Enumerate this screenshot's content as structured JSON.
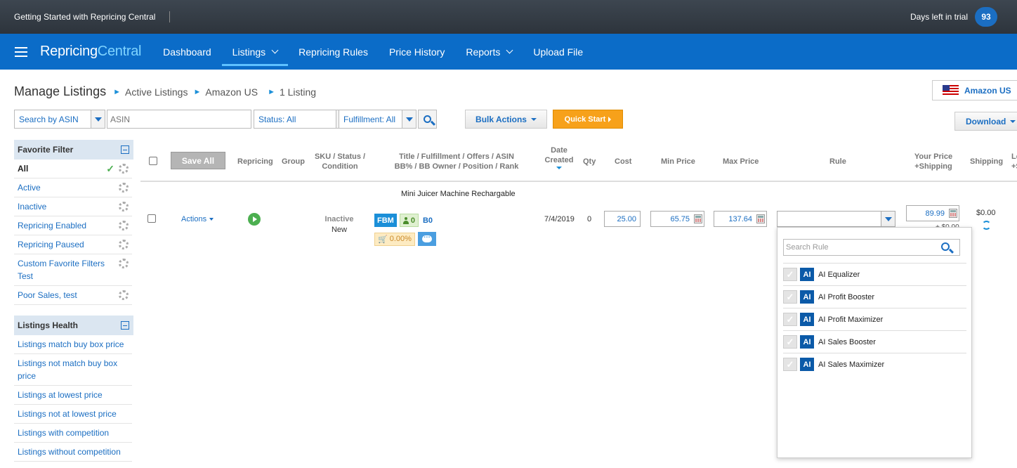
{
  "topbar": {
    "getting_started": "Getting Started with Repricing Central",
    "trial_label": "Days left in trial",
    "trial_days": "93"
  },
  "nav": {
    "logo_a": "Repricing",
    "logo_b": "Central",
    "items": [
      {
        "label": "Dashboard"
      },
      {
        "label": "Listings"
      },
      {
        "label": "Repricing Rules"
      },
      {
        "label": "Price History"
      },
      {
        "label": "Reports"
      },
      {
        "label": "Upload File"
      }
    ]
  },
  "breadcrumb": {
    "title": "Manage Listings",
    "items": [
      "Active Listings",
      "Amazon US",
      "1 Listing"
    ]
  },
  "marketplace": {
    "label": "Amazon US"
  },
  "download": {
    "label": "Download"
  },
  "filters": {
    "search_by": "Search by ASIN",
    "asin_placeholder": "ASIN",
    "status": "Status: All",
    "fulfillment": "Fulfillment: All",
    "bulk_actions": "Bulk Actions",
    "quick_start": "Quick Start"
  },
  "sidebar": {
    "favorite_title": "Favorite Filter",
    "favorite_items": [
      "All",
      "Active",
      "Inactive",
      "Repricing Enabled",
      "Repricing Paused",
      "Custom Favorite Filters Test",
      "Poor Sales, test"
    ],
    "health_title": "Listings Health",
    "health_items": [
      "Listings match buy box price",
      "Listings not match buy box price",
      "Listings at lowest price",
      "Listings not at lowest price",
      "Listings with competition",
      "Listings without competition"
    ]
  },
  "table": {
    "save_all": "Save All",
    "headers": {
      "repricing": "Repricing",
      "group": "Group",
      "sku1": "SKU / Status /",
      "sku2": "Condition",
      "title1": "Title / Fulfillment / Offers / ASIN",
      "title2": "BB% / BB Owner / Position / Rank",
      "date1": "Date",
      "date2": "Created",
      "qty": "Qty",
      "cost": "Cost",
      "min": "Min Price",
      "max": "Max Price",
      "rule": "Rule",
      "yp1": "Your Price",
      "yp2": "+Shipping",
      "ship": "Shipping",
      "last1": "Lo",
      "last2": "+S"
    },
    "row": {
      "title": "Mini Juicer Machine Rechargable",
      "actions": "Actions",
      "status": "Inactive",
      "condition": "New",
      "fulfillment": "FBM",
      "offers": "0",
      "asin": "B0",
      "bb_percent": "0.00%",
      "date": "7/4/2019",
      "qty": "0",
      "cost": "25.00",
      "min_price": "65.75",
      "max_price": "137.64",
      "your_price": "89.99",
      "your_price_ship": "+ $0.00",
      "shipping": "$0.00"
    }
  },
  "rule_dropdown": {
    "search_placeholder": "Search Rule",
    "badge": "AI",
    "items": [
      "AI Equalizer",
      "AI Profit Booster",
      "AI Profit Maximizer",
      "AI Sales Booster",
      "AI Sales Maximizer"
    ]
  }
}
